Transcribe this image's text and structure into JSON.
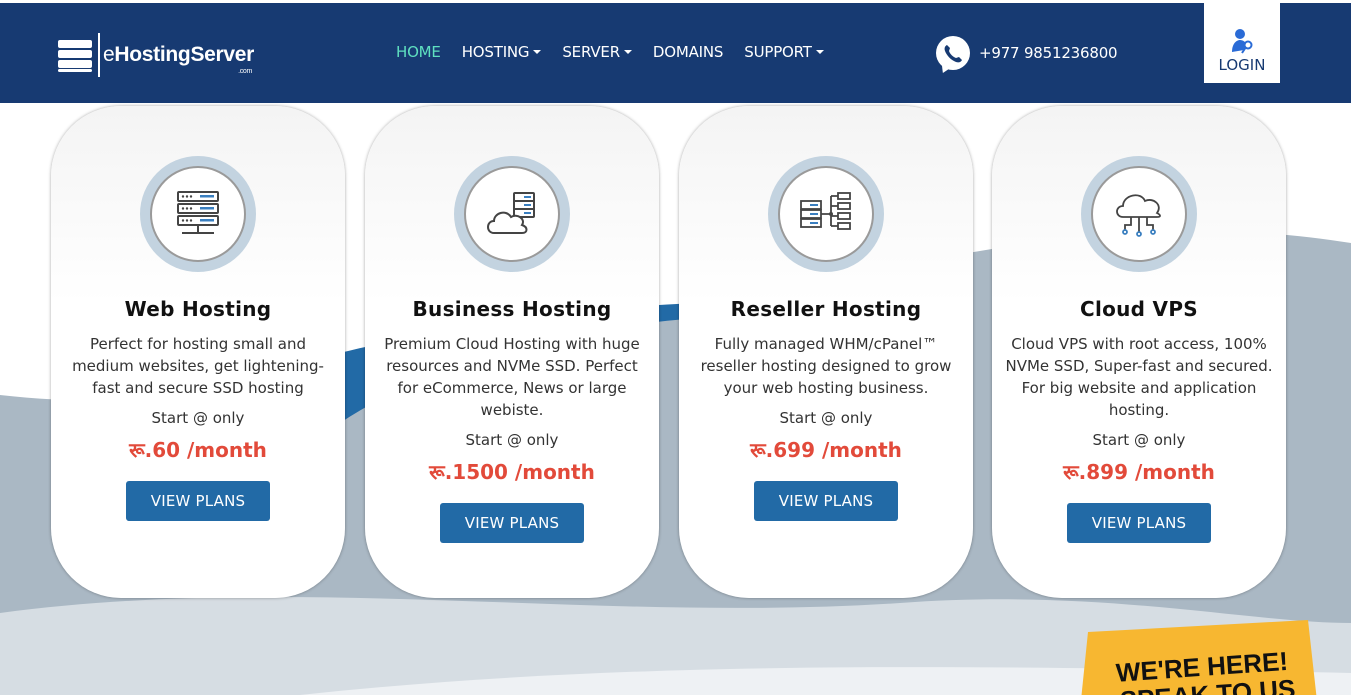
{
  "header": {
    "logo": {
      "prefix": "e",
      "name": "HostingServer",
      "suffix": ".com"
    },
    "nav": [
      {
        "label": "HOME",
        "active": true,
        "dropdown": false
      },
      {
        "label": "HOSTING",
        "active": false,
        "dropdown": true
      },
      {
        "label": "SERVER",
        "active": false,
        "dropdown": true
      },
      {
        "label": "DOMAINS",
        "active": false,
        "dropdown": false
      },
      {
        "label": "SUPPORT",
        "active": false,
        "dropdown": true
      }
    ],
    "phone": "+977 9851236800",
    "login_label": "LOGIN"
  },
  "cards": [
    {
      "icon": "server-rack-icon",
      "title": "Web Hosting",
      "description": "Perfect for hosting small and medium websites, get lightening-fast and secure SSD hosting",
      "start": "Start @ only",
      "price": "रू.60 /month",
      "button": "VIEW PLANS"
    },
    {
      "icon": "cloud-server-icon",
      "title": "Business Hosting",
      "description": "Premium Cloud Hosting with huge resources and NVMe SSD. Perfect for eCommerce, News or large webiste.",
      "start": "Start @ only",
      "price": "रू.1500 /month",
      "button": "VIEW PLANS"
    },
    {
      "icon": "reseller-network-icon",
      "title": "Reseller Hosting",
      "description": "Fully managed WHM/cPanel™ reseller hosting designed to grow your web hosting business.",
      "start": "Start @ only",
      "price": "रू.699 /month",
      "button": "VIEW PLANS"
    },
    {
      "icon": "cloud-network-icon",
      "title": "Cloud VPS",
      "description": "Cloud VPS with root access, 100% NVMe SSD, Super-fast and secured. For big website and application hosting.",
      "start": "Start @ only",
      "price": "रू.899 /month",
      "button": "VIEW PLANS"
    }
  ],
  "chat_badge": {
    "line1": "WE'RE HERE!",
    "line2": "SPEAK TO US"
  },
  "colors": {
    "header_bg": "#173a72",
    "nav_active": "#5fe0c0",
    "button": "#226aa6",
    "price": "#e24a3a",
    "badge": "#f7b731"
  }
}
